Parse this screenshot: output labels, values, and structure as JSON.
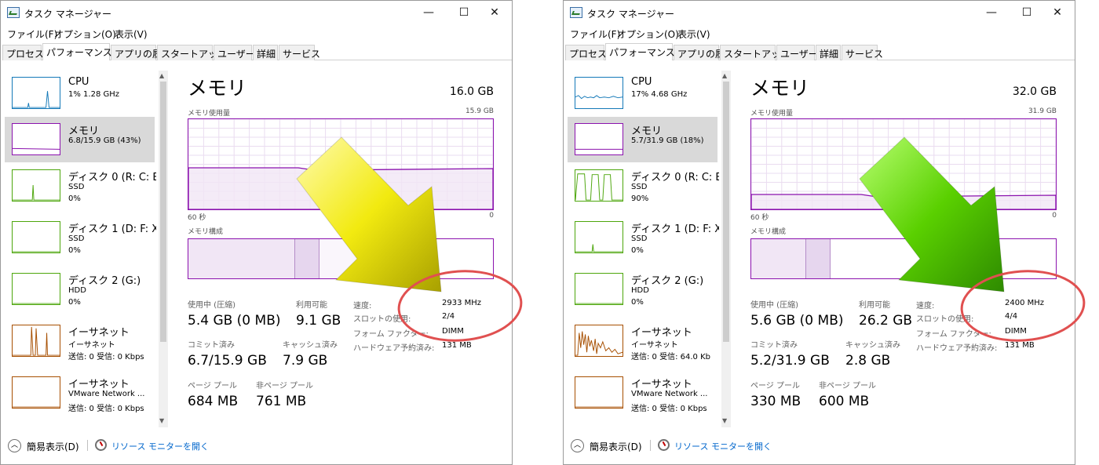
{
  "windows": [
    {
      "title": "タスク マネージャー",
      "window_buttons": {
        "minimize": "—",
        "maximize": "☐",
        "close": "✕"
      },
      "menu": [
        "ファイル(F)",
        "オプション(O)",
        "表示(V)"
      ],
      "tabs": [
        "プロセス",
        "パフォーマンス",
        "アプリの履歴",
        "スタートアップ",
        "ユーザー",
        "詳細",
        "サービス"
      ],
      "active_tab": "パフォーマンス",
      "sidebar": [
        {
          "name": "CPU",
          "l2": "1% 1.28 GHz",
          "l3": "",
          "color": "#1479b8",
          "selected": false
        },
        {
          "name": "メモリ",
          "l2": "6.8/15.9 GB (43%)",
          "l3": "",
          "color": "#8b12ae",
          "selected": true
        },
        {
          "name": "ディスク 0 (R: C: E",
          "l2": "SSD",
          "l3": "0%",
          "color": "#4da60c",
          "selected": false
        },
        {
          "name": "ディスク 1 (D: F: X",
          "l2": "SSD",
          "l3": "0%",
          "color": "#4da60c",
          "selected": false
        },
        {
          "name": "ディスク 2 (G:)",
          "l2": "HDD",
          "l3": "0%",
          "color": "#4da60c",
          "selected": false
        },
        {
          "name": "イーサネット",
          "l2": "イーサネット",
          "l3": "送信: 0 受信: 0 Kbps",
          "color": "#a74f01",
          "selected": false
        },
        {
          "name": "イーサネット",
          "l2": "VMware Network ...",
          "l3": "送信: 0 受信: 0 Kbps",
          "color": "#a74f01",
          "selected": false
        }
      ],
      "main": {
        "title": "メモリ",
        "total": "16.0 GB",
        "usage_label": "メモリ使用量",
        "usage_max": "15.9 GB",
        "time_left": "60 秒",
        "time_right": "0",
        "composition_label": "メモリ構成",
        "in_use_label": "使用中 (圧縮)",
        "in_use": "5.4 GB (0 MB)",
        "available_label": "利用可能",
        "available": "9.1 GB",
        "committed_label": "コミット済み",
        "committed": "6.7/15.9 GB",
        "cached_label": "キャッシュ済み",
        "cached": "7.9 GB",
        "paged_label": "ページ プール",
        "paged": "684 MB",
        "nonpaged_label": "非ページ プール",
        "nonpaged": "761 MB",
        "speed_label": "速度:",
        "speed": "2933 MHz",
        "slots_label": "スロットの使用:",
        "slots": "2/4",
        "form_label": "フォーム ファクター:",
        "form": "DIMM",
        "reserved_label": "ハードウェア予約済み:",
        "reserved": "131 MB"
      },
      "footer": {
        "fewer_details": "簡易表示(D)",
        "resource_monitor": "リソース モニターを開く"
      },
      "arrow_color": "yellow"
    },
    {
      "title": "タスク マネージャー",
      "window_buttons": {
        "minimize": "—",
        "maximize": "☐",
        "close": "✕"
      },
      "menu": [
        "ファイル(F)",
        "オプション(O)",
        "表示(V)"
      ],
      "tabs": [
        "プロセス",
        "パフォーマンス",
        "アプリの履歴",
        "スタートアップ",
        "ユーザー",
        "詳細",
        "サービス"
      ],
      "active_tab": "パフォーマンス",
      "sidebar": [
        {
          "name": "CPU",
          "l2": "17% 4.68 GHz",
          "l3": "",
          "color": "#1479b8",
          "selected": false
        },
        {
          "name": "メモリ",
          "l2": "5.7/31.9 GB (18%)",
          "l3": "",
          "color": "#8b12ae",
          "selected": true
        },
        {
          "name": "ディスク 0 (R: C: E",
          "l2": "SSD",
          "l3": "90%",
          "color": "#4da60c",
          "selected": false
        },
        {
          "name": "ディスク 1 (D: F: X",
          "l2": "SSD",
          "l3": "0%",
          "color": "#4da60c",
          "selected": false
        },
        {
          "name": "ディスク 2 (G:)",
          "l2": "HDD",
          "l3": "0%",
          "color": "#4da60c",
          "selected": false
        },
        {
          "name": "イーサネット",
          "l2": "イーサネット",
          "l3": "送信: 0 受信: 64.0 Kb",
          "color": "#a74f01",
          "selected": false
        },
        {
          "name": "イーサネット",
          "l2": "VMware Network ...",
          "l3": "送信: 0 受信: 0 Kbps",
          "color": "#a74f01",
          "selected": false
        }
      ],
      "main": {
        "title": "メモリ",
        "total": "32.0 GB",
        "usage_label": "メモリ使用量",
        "usage_max": "31.9 GB",
        "time_left": "60 秒",
        "time_right": "0",
        "composition_label": "メモリ構成",
        "in_use_label": "使用中 (圧縮)",
        "in_use": "5.6 GB (0 MB)",
        "available_label": "利用可能",
        "available": "26.2 GB",
        "committed_label": "コミット済み",
        "committed": "5.2/31.9 GB",
        "cached_label": "キャッシュ済み",
        "cached": "2.8 GB",
        "paged_label": "ページ プール",
        "paged": "330 MB",
        "nonpaged_label": "非ページ プール",
        "nonpaged": "600 MB",
        "speed_label": "速度:",
        "speed": "2400 MHz",
        "slots_label": "スロットの使用:",
        "slots": "4/4",
        "form_label": "フォーム ファクター:",
        "form": "DIMM",
        "reserved_label": "ハードウェア予約済み:",
        "reserved": "131 MB"
      },
      "footer": {
        "fewer_details": "簡易表示(D)",
        "resource_monitor": "リソース モニターを開く"
      },
      "arrow_color": "green"
    }
  ],
  "colors": {
    "memory": "#8b12ae",
    "cpu": "#1479b8",
    "disk": "#4da60c",
    "ethernet": "#a74f01",
    "highlight_circle": "#e05050"
  }
}
